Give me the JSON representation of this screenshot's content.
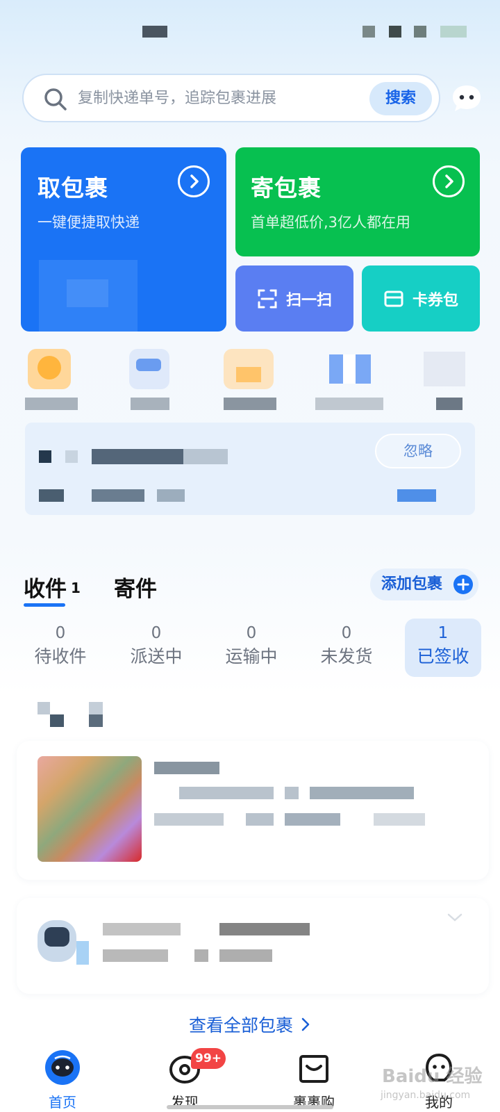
{
  "search": {
    "placeholder": "复制快递单号，追踪包裹进展",
    "button_label": "搜索"
  },
  "cards": {
    "pick": {
      "title": "取包裹",
      "subtitle": "一键便捷取快递"
    },
    "send": {
      "title": "寄包裹",
      "subtitle": "首单超低价,3亿人都在用"
    },
    "scan_label": "扫一扫",
    "coupon_label": "卡券包"
  },
  "notice": {
    "ignore_label": "忽略"
  },
  "tabs": {
    "receive_label": "收件",
    "receive_count": "1",
    "send_label": "寄件",
    "add_package_label": "添加包裹"
  },
  "filters": [
    {
      "count": "0",
      "label": "待收件"
    },
    {
      "count": "0",
      "label": "派送中"
    },
    {
      "count": "0",
      "label": "运输中"
    },
    {
      "count": "0",
      "label": "未发货"
    },
    {
      "count": "1",
      "label": "已签收"
    }
  ],
  "view_all_label": "查看全部包裹",
  "bottom_nav": [
    {
      "label": "首页",
      "icon": "home-robot-icon"
    },
    {
      "label": "发现",
      "icon": "discover-icon"
    },
    {
      "label": "裹裹购",
      "icon": "shopping-bag-icon"
    },
    {
      "label": "我的",
      "icon": "profile-icon"
    }
  ],
  "badge": "99+",
  "watermark": {
    "brand": "Baidu 经验",
    "url": "jingyan.baidu.com"
  },
  "colors": {
    "primary_blue": "#1a73f5",
    "send_green": "#07c050",
    "scan_blue": "#5a7ef2",
    "coupon_teal": "#16cfc5",
    "badge_red": "#f24444"
  }
}
